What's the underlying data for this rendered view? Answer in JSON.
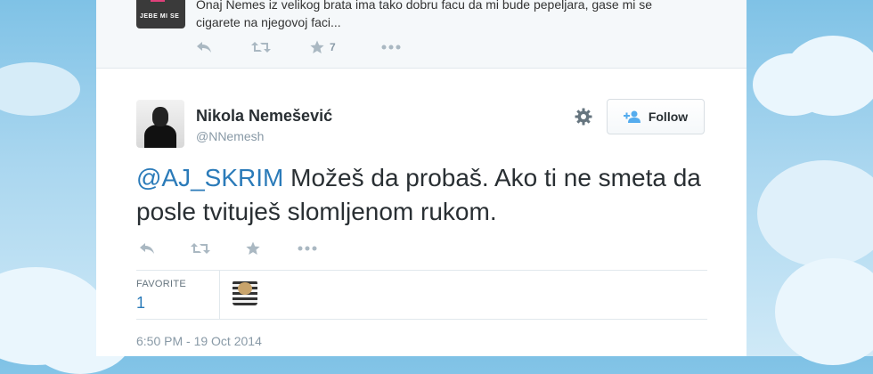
{
  "previous_tweet": {
    "avatar_caption": "JEBE MI SE",
    "text": "Onaj Nemes iz velikog brata ima tako dobru facu da mi bude pepeljara, gase mi se cigarete na njegovoj faci...",
    "favorite_count": "7",
    "icons": [
      "reply-icon",
      "retweet-icon",
      "star-icon",
      "more-icon"
    ]
  },
  "tweet": {
    "author_name": "Nikola Nemešević",
    "author_handle": "@NNemesh",
    "follow_label": "Follow",
    "mention": "@AJ_SKRIM",
    "text": " Možeš da probaš. Ako ti ne smeta da posle tvituješ slomljenom rukom.",
    "favorites_label": "FAVORITE",
    "favorites_count": "1",
    "timestamp": "6:50 PM - 19 Oct 2014",
    "icons": [
      "reply-icon",
      "retweet-icon",
      "star-icon",
      "more-icon",
      "gear-icon",
      "add-user-icon"
    ]
  },
  "colors": {
    "link": "#2b7bb9",
    "icon_gray": "#aab8c2",
    "sky": "#7fc2e6"
  }
}
